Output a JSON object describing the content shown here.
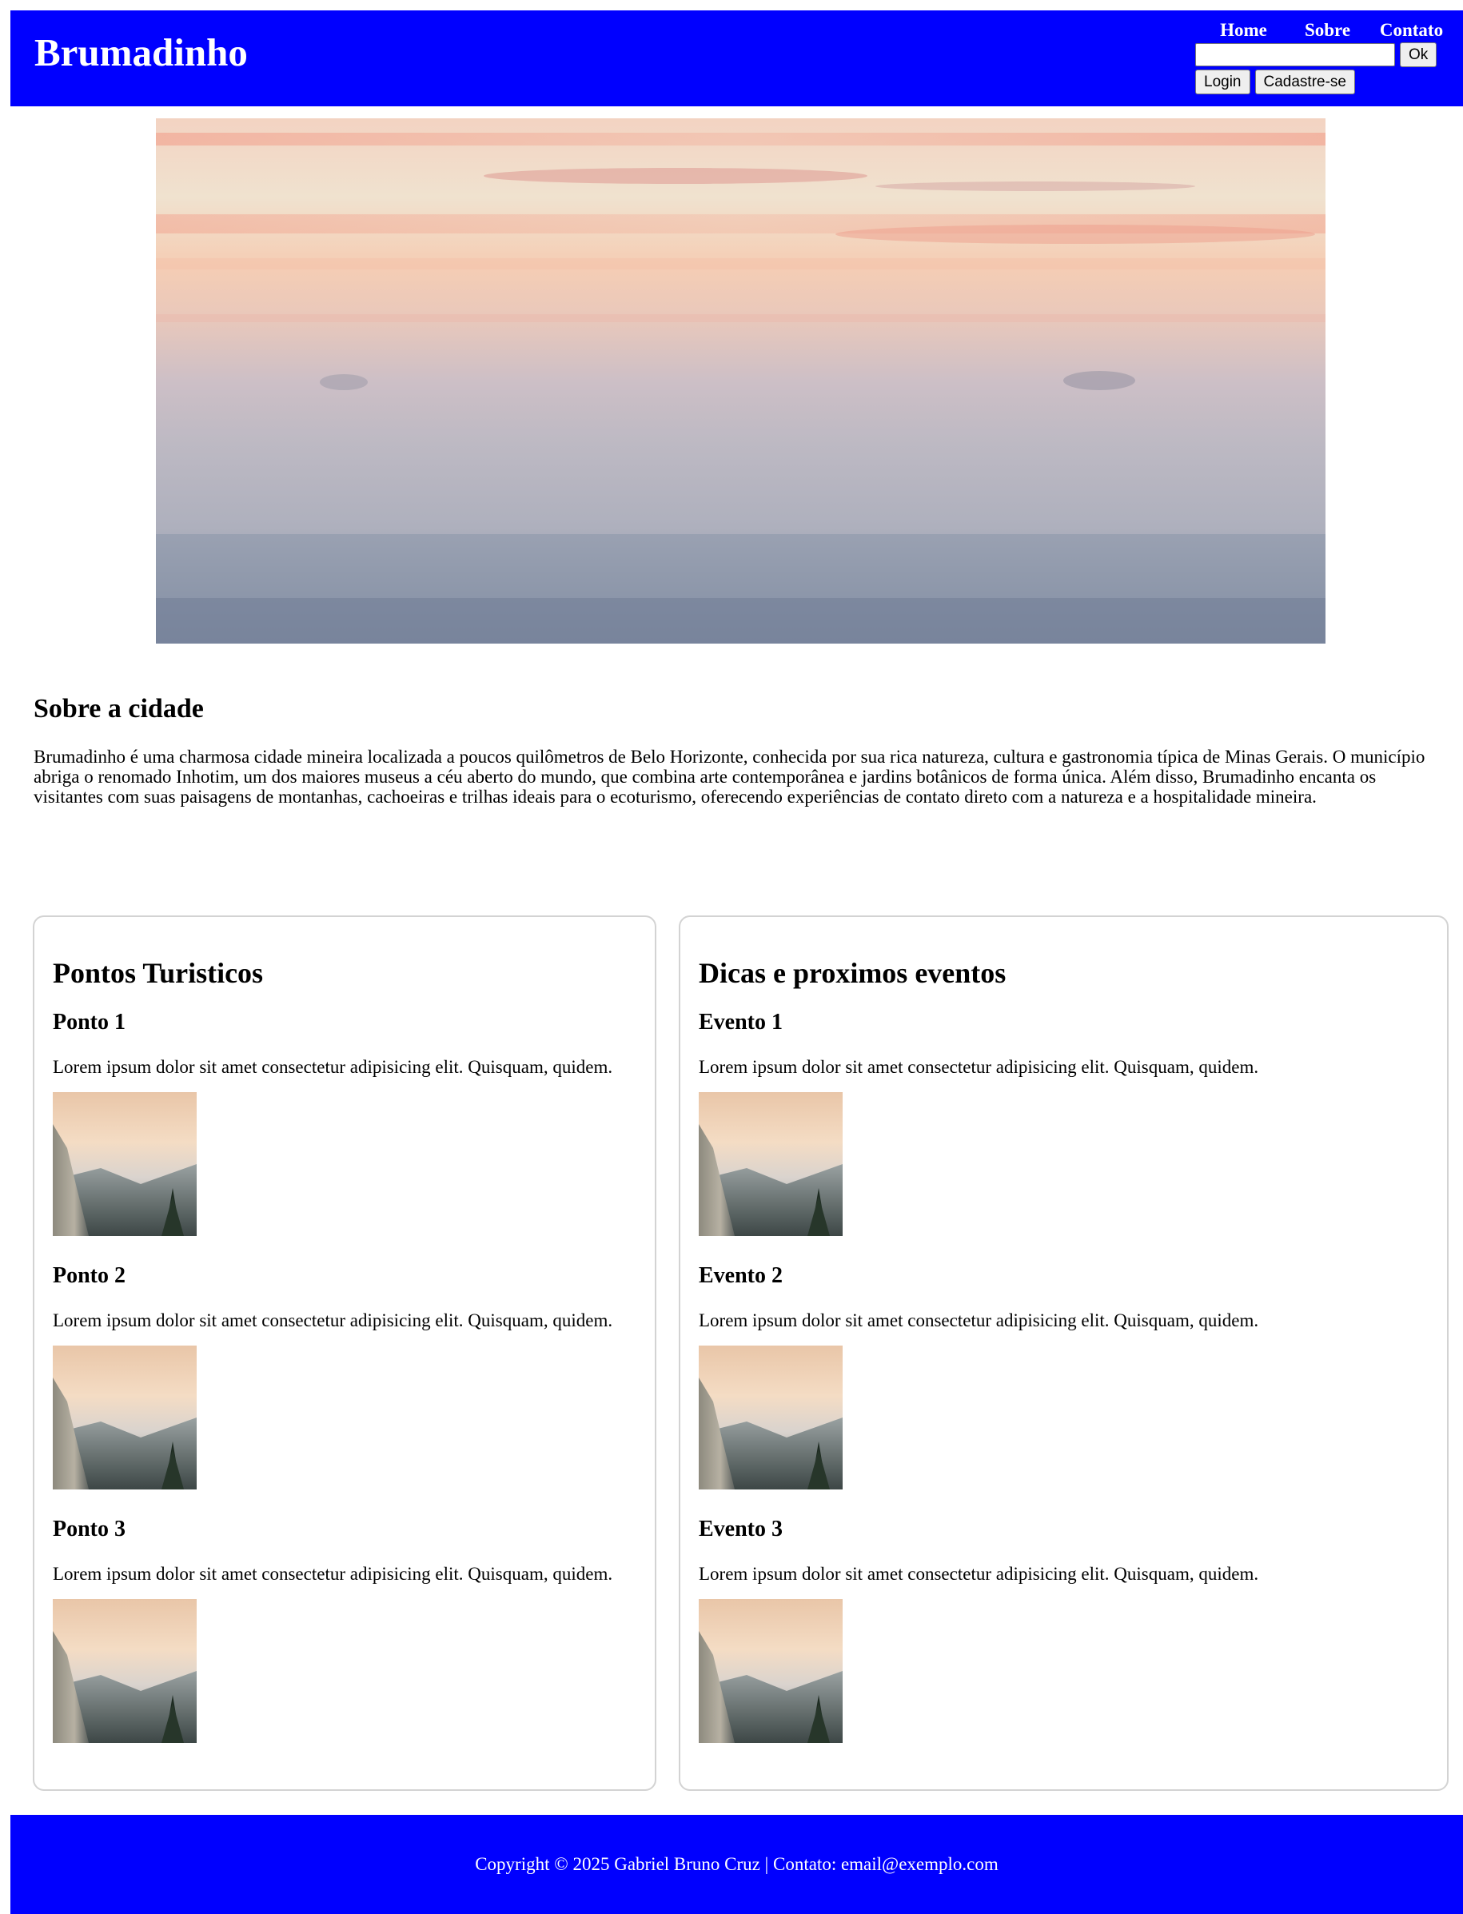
{
  "header": {
    "logo": "Brumadinho",
    "nav": [
      "Home",
      "Sobre",
      "Contato"
    ],
    "search": {
      "value": "",
      "placeholder": ""
    },
    "search_button": "Ok",
    "login_button": "Login",
    "signup_button": "Cadastre-se"
  },
  "about": {
    "title": "Sobre a cidade",
    "text": "Brumadinho é uma charmosa cidade mineira localizada a poucos quilômetros de Belo Horizonte, conhecida por sua rica natureza, cultura e gastronomia típica de Minas Gerais. O município abriga o renomado Inhotim, um dos maiores museus a céu aberto do mundo, que combina arte contemporânea e jardins botânicos de forma única. Além disso, Brumadinho encanta os visitantes com suas paisagens de montanhas, cachoeiras e trilhas ideais para o ecoturismo, oferecendo experiências de contato direto com a natureza e a hospitalidade mineira."
  },
  "tourist": {
    "title": "Pontos Turisticos",
    "items": [
      {
        "title": "Ponto 1",
        "text": "Lorem ipsum dolor sit amet consectetur adipisicing elit. Quisquam, quidem."
      },
      {
        "title": "Ponto 2",
        "text": "Lorem ipsum dolor sit amet consectetur adipisicing elit. Quisquam, quidem."
      },
      {
        "title": "Ponto 3",
        "text": "Lorem ipsum dolor sit amet consectetur adipisicing elit. Quisquam, quidem."
      }
    ]
  },
  "events": {
    "title": "Dicas e proximos eventos",
    "items": [
      {
        "title": "Evento 1",
        "text": "Lorem ipsum dolor sit amet consectetur adipisicing elit. Quisquam, quidem."
      },
      {
        "title": "Evento 2",
        "text": "Lorem ipsum dolor sit amet consectetur adipisicing elit. Quisquam, quidem."
      },
      {
        "title": "Evento 3",
        "text": "Lorem ipsum dolor sit amet consectetur adipisicing elit. Quisquam, quidem."
      }
    ]
  },
  "footer": {
    "text": "Copyright © 2025 Gabriel Bruno Cruz | Contato: email@exemplo.com"
  },
  "colors": {
    "header_bg": "#0000ff",
    "footer_bg": "#0000ff",
    "header_text": "#ffffff",
    "card_border": "#d3d3d3"
  }
}
